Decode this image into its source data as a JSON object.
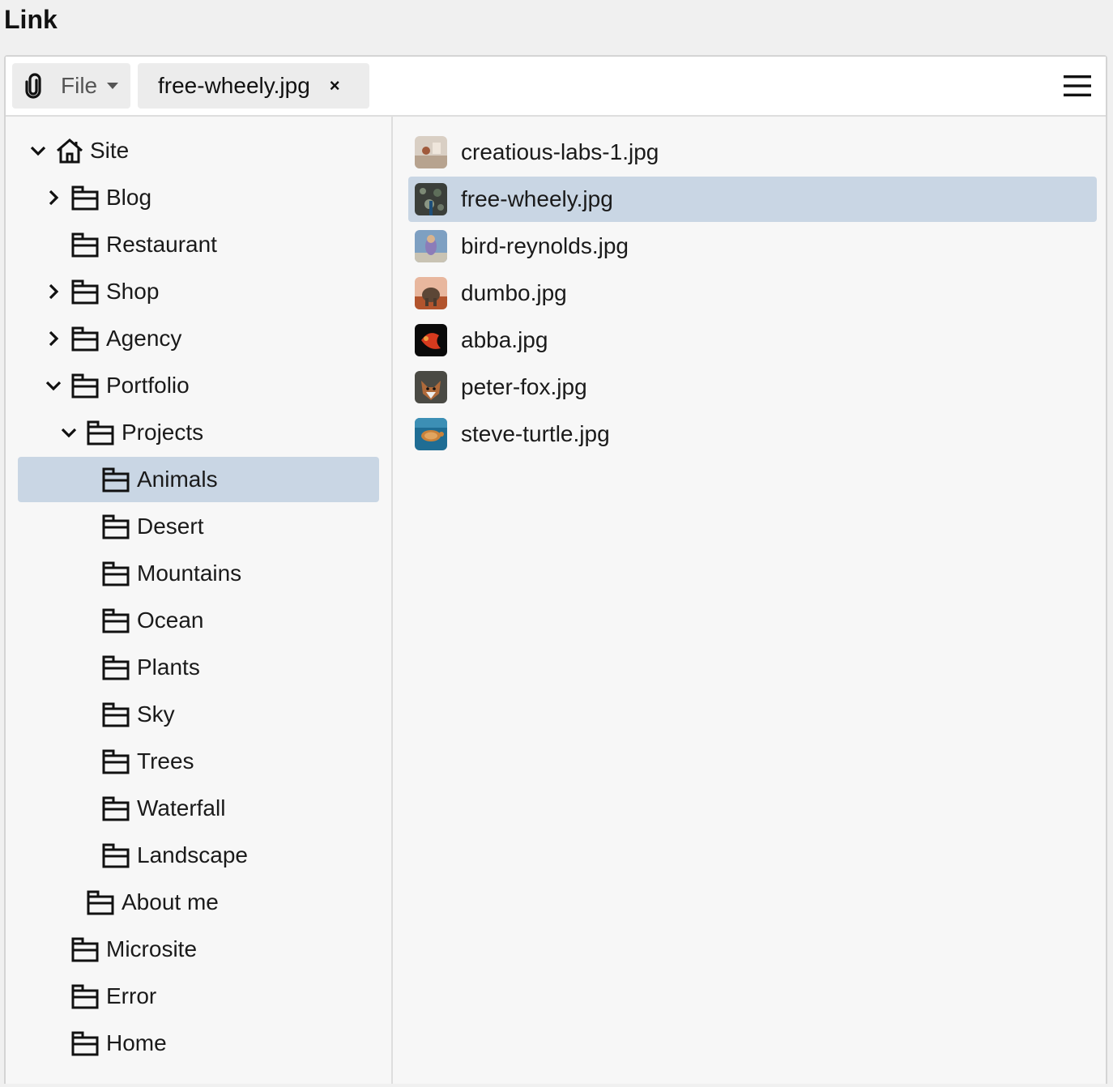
{
  "dialog": {
    "title": "Link"
  },
  "toolbar": {
    "file_button_label": "File",
    "selected_file_chip": "free-wheely.jpg",
    "close_glyph": "×",
    "icons": {
      "attach": "paperclip-icon",
      "dropdown": "caret-down-icon",
      "menu": "hamburger-menu-icon"
    }
  },
  "tree": {
    "items": [
      {
        "label": "Site",
        "icon": "home-icon",
        "expanded": true,
        "has_children": true
      },
      {
        "label": "Blog",
        "icon": "folder-icon",
        "expanded": false,
        "has_children": true
      },
      {
        "label": "Restaurant",
        "icon": "folder-icon",
        "has_children": false
      },
      {
        "label": "Shop",
        "icon": "folder-icon",
        "expanded": false,
        "has_children": true
      },
      {
        "label": "Agency",
        "icon": "folder-icon",
        "expanded": false,
        "has_children": true
      },
      {
        "label": "Portfolio",
        "icon": "folder-icon",
        "expanded": true,
        "has_children": true
      },
      {
        "label": "Projects",
        "icon": "folder-icon",
        "expanded": true,
        "has_children": true
      },
      {
        "label": "Animals",
        "icon": "folder-icon",
        "has_children": false,
        "selected": true
      },
      {
        "label": "Desert",
        "icon": "folder-icon",
        "has_children": false
      },
      {
        "label": "Mountains",
        "icon": "folder-icon",
        "has_children": false
      },
      {
        "label": "Ocean",
        "icon": "folder-icon",
        "has_children": false
      },
      {
        "label": "Plants",
        "icon": "folder-icon",
        "has_children": false
      },
      {
        "label": "Sky",
        "icon": "folder-icon",
        "has_children": false
      },
      {
        "label": "Trees",
        "icon": "folder-icon",
        "has_children": false
      },
      {
        "label": "Waterfall",
        "icon": "folder-icon",
        "has_children": false
      },
      {
        "label": "Landscape",
        "icon": "folder-icon",
        "has_children": false
      },
      {
        "label": "About me",
        "icon": "folder-icon",
        "has_children": false
      },
      {
        "label": "Microsite",
        "icon": "folder-icon",
        "has_children": false
      },
      {
        "label": "Error",
        "icon": "folder-icon",
        "has_children": false
      },
      {
        "label": "Home",
        "icon": "folder-icon",
        "has_children": false
      }
    ]
  },
  "files": {
    "items": [
      {
        "name": "creatious-labs-1.jpg",
        "selected": false
      },
      {
        "name": "free-wheely.jpg",
        "selected": true
      },
      {
        "name": "bird-reynolds.jpg",
        "selected": false
      },
      {
        "name": "dumbo.jpg",
        "selected": false
      },
      {
        "name": "abba.jpg",
        "selected": false
      },
      {
        "name": "peter-fox.jpg",
        "selected": false
      },
      {
        "name": "steve-turtle.jpg",
        "selected": false
      }
    ]
  },
  "colors": {
    "selection": "#c9d6e4",
    "panel_bg": "#f7f7f7",
    "page_bg": "#f0f0f0",
    "chip_bg": "#ececec"
  }
}
